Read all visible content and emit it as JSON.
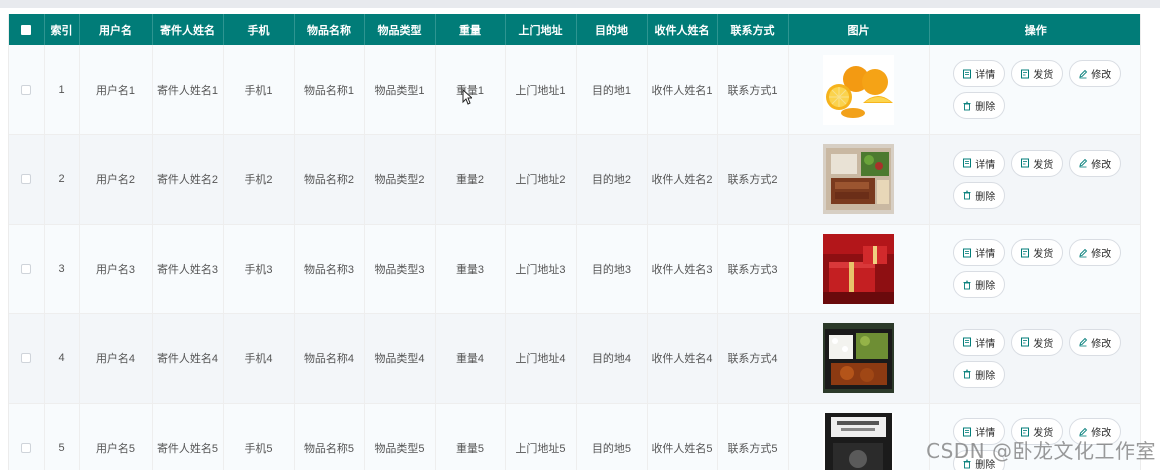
{
  "table": {
    "headers": [
      "索引",
      "用户名",
      "寄件人姓名",
      "手机",
      "物品名称",
      "物品类型",
      "重量",
      "上门地址",
      "目的地",
      "收件人姓名",
      "联系方式",
      "图片",
      "操作"
    ],
    "actions": {
      "detail": "详情",
      "ship": "发货",
      "edit": "修改",
      "delete": "删除"
    },
    "rows": [
      {
        "index": "1",
        "username": "用户名1",
        "sender": "寄件人姓名1",
        "phone": "手机1",
        "item_name": "物品名称1",
        "item_type": "物品类型1",
        "weight": "重量1",
        "pickup": "上门地址1",
        "destination": "目的地1",
        "receiver": "收件人姓名1",
        "contact": "联系方式1",
        "image": "oranges"
      },
      {
        "index": "2",
        "username": "用户名2",
        "sender": "寄件人姓名2",
        "phone": "手机2",
        "item_name": "物品名称2",
        "item_type": "物品类型2",
        "weight": "重量2",
        "pickup": "上门地址2",
        "destination": "目的地2",
        "receiver": "收件人姓名2",
        "contact": "联系方式2",
        "image": "bento-box"
      },
      {
        "index": "3",
        "username": "用户名3",
        "sender": "寄件人姓名3",
        "phone": "手机3",
        "item_name": "物品名称3",
        "item_type": "物品类型3",
        "weight": "重量3",
        "pickup": "上门地址3",
        "destination": "目的地3",
        "receiver": "收件人姓名3",
        "contact": "联系方式3",
        "image": "red-gift-box"
      },
      {
        "index": "4",
        "username": "用户名4",
        "sender": "寄件人姓名4",
        "phone": "手机4",
        "item_name": "物品名称4",
        "item_type": "物品类型4",
        "weight": "重量4",
        "pickup": "上门地址4",
        "destination": "目的地4",
        "receiver": "收件人姓名4",
        "contact": "联系方式4",
        "image": "rice-meal-box"
      },
      {
        "index": "5",
        "username": "用户名5",
        "sender": "寄件人姓名5",
        "phone": "手机5",
        "item_name": "物品名称5",
        "item_type": "物品类型5",
        "weight": "重量5",
        "pickup": "上门地址5",
        "destination": "目的地5",
        "receiver": "收件人姓名5",
        "contact": "联系方式5",
        "image": "book-cover"
      }
    ]
  },
  "watermark": "CSDN @卧龙文化工作室",
  "colors": {
    "header_bg": "#017c78",
    "header_text": "#ffffff",
    "row_bg": "#f8fbfd",
    "row_bg_alt": "#f3f6f9"
  }
}
